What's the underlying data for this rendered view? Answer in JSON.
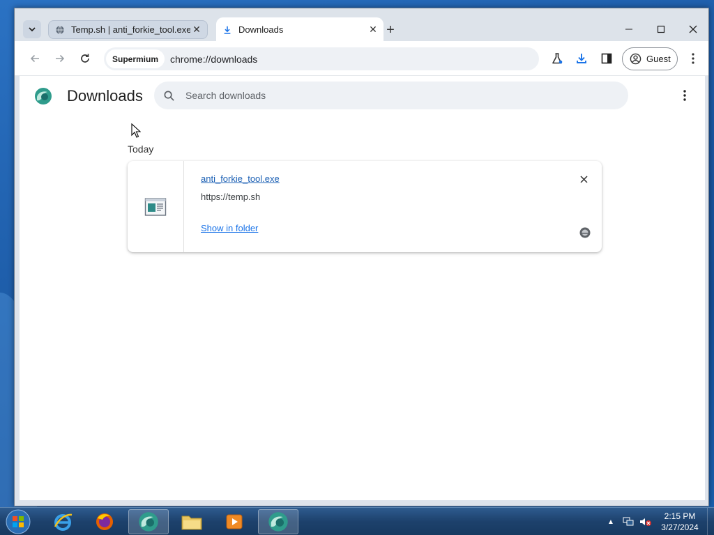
{
  "tabs": [
    {
      "title": "Temp.sh | anti_forkie_tool.exe",
      "icon": "globe-icon",
      "active": false
    },
    {
      "title": "Downloads",
      "icon": "download-icon",
      "active": true
    }
  ],
  "toolbar": {
    "chip": "Supermium",
    "url": "chrome://downloads",
    "profile": "Guest"
  },
  "page": {
    "title": "Downloads",
    "search_placeholder": "Search downloads"
  },
  "downloads": {
    "date_header": "Today",
    "items": [
      {
        "file_name": "anti_forkie_tool.exe",
        "source": "https://temp.sh",
        "action": "Show in folder"
      }
    ]
  },
  "taskbar": {
    "apps": [
      "internet-explorer",
      "firefox",
      "supermium",
      "file-explorer",
      "media-player",
      "supermium"
    ],
    "time": "2:15 PM",
    "date": "3/27/2024"
  },
  "colors": {
    "accent": "#1a73e8",
    "link": "#1a5fb4",
    "taskbar": "#1d416c"
  }
}
